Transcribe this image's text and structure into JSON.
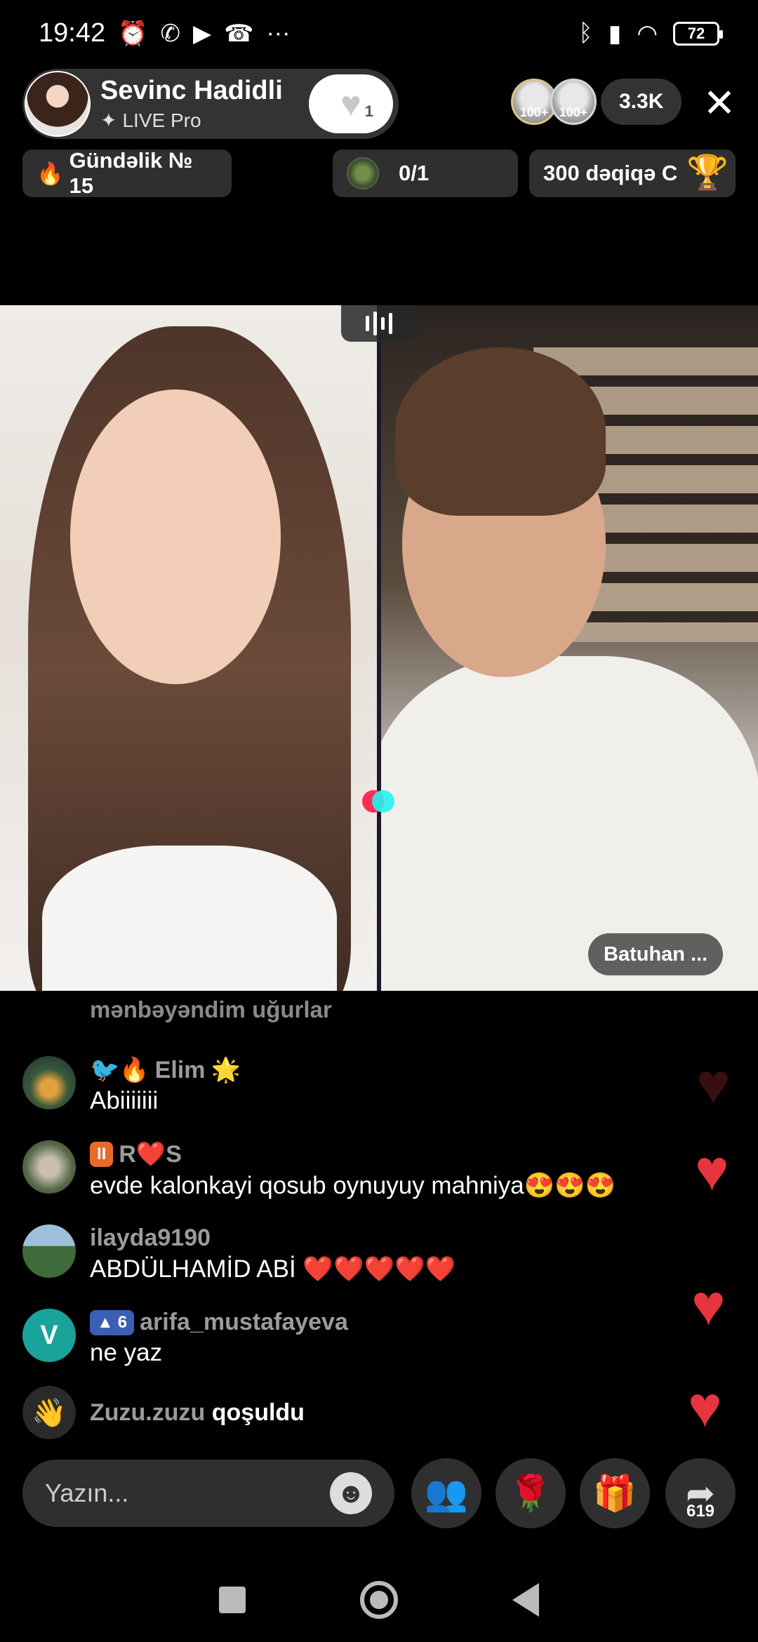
{
  "status_bar": {
    "time": "19:42",
    "left_icons": [
      "alarm-icon",
      "whatsapp-icon",
      "video-icon",
      "missed-call-icon",
      "more-icon"
    ],
    "right_icons": [
      "bluetooth-icon",
      "signal-icon",
      "wifi-icon"
    ],
    "battery": "72"
  },
  "host": {
    "name": "Sevinc Hadidli",
    "subtitle": "LIVE Pro",
    "follow_count": "1"
  },
  "top_right": {
    "badge1": "100+",
    "badge2": "100+",
    "viewer_count": "3.3K",
    "close": "✕"
  },
  "pills": {
    "daily": "Gündəlik № 15",
    "goal": "0/1",
    "minutes": "300 dəqiqə C"
  },
  "video": {
    "guest_name": "Batuhan ..."
  },
  "chat": {
    "faded_line": "mənbəyəndim uğurlar",
    "messages": [
      {
        "user": "Elim",
        "prefix": "🐦🔥",
        "suffix": "🌟",
        "text": "Abiiiiiii"
      },
      {
        "user": "R❤️S",
        "prefix": "",
        "suffix": "",
        "badge": "II",
        "text": "evde kalonkayi qosub oynuyuy mahniya😍😍😍"
      },
      {
        "user": "ilayda9190",
        "text": "ABDÜLHAMİD ABİ ❤️❤️❤️❤️❤️"
      },
      {
        "user": "arifa_mustafayeva",
        "level": "6",
        "avatar_letter": "V",
        "text": "ne yaz"
      }
    ],
    "join": {
      "user": "Zuzu.zuzu",
      "action": "qoşuldu"
    }
  },
  "composer": {
    "placeholder": "Yazın..."
  },
  "share_count": "619",
  "colors": {
    "heart": "#e7353f",
    "level_badge": "#3a5fb5",
    "avatar_v": "#1aa39a",
    "pk_red": "#ff2d55",
    "pk_cyan": "#25f4ee"
  }
}
